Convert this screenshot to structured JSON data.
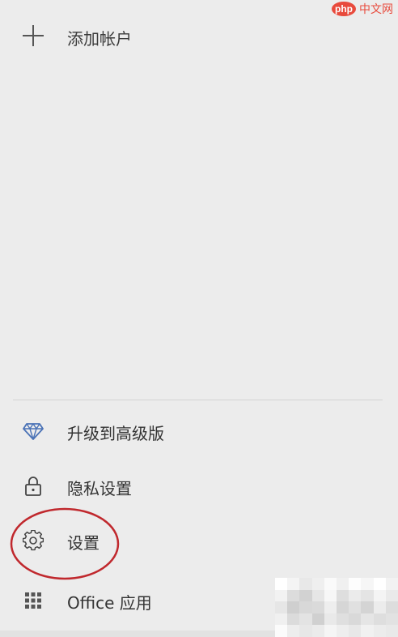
{
  "watermark": {
    "badge": "php",
    "text": "中文网"
  },
  "account": {
    "add_label": "添加帐户"
  },
  "menu": {
    "upgrade": "升级到高级版",
    "privacy": "隐私设置",
    "settings": "设置",
    "office": "Office 应用"
  },
  "colors": {
    "background": "#ececec",
    "accent_icon": "#4a72b6",
    "highlight": "#c0282d",
    "watermark": "#e84a3c"
  },
  "icons": {
    "add": "plus-icon",
    "upgrade": "diamond-icon",
    "privacy": "lock-icon",
    "settings": "gear-icon",
    "office": "app-grid-icon"
  }
}
